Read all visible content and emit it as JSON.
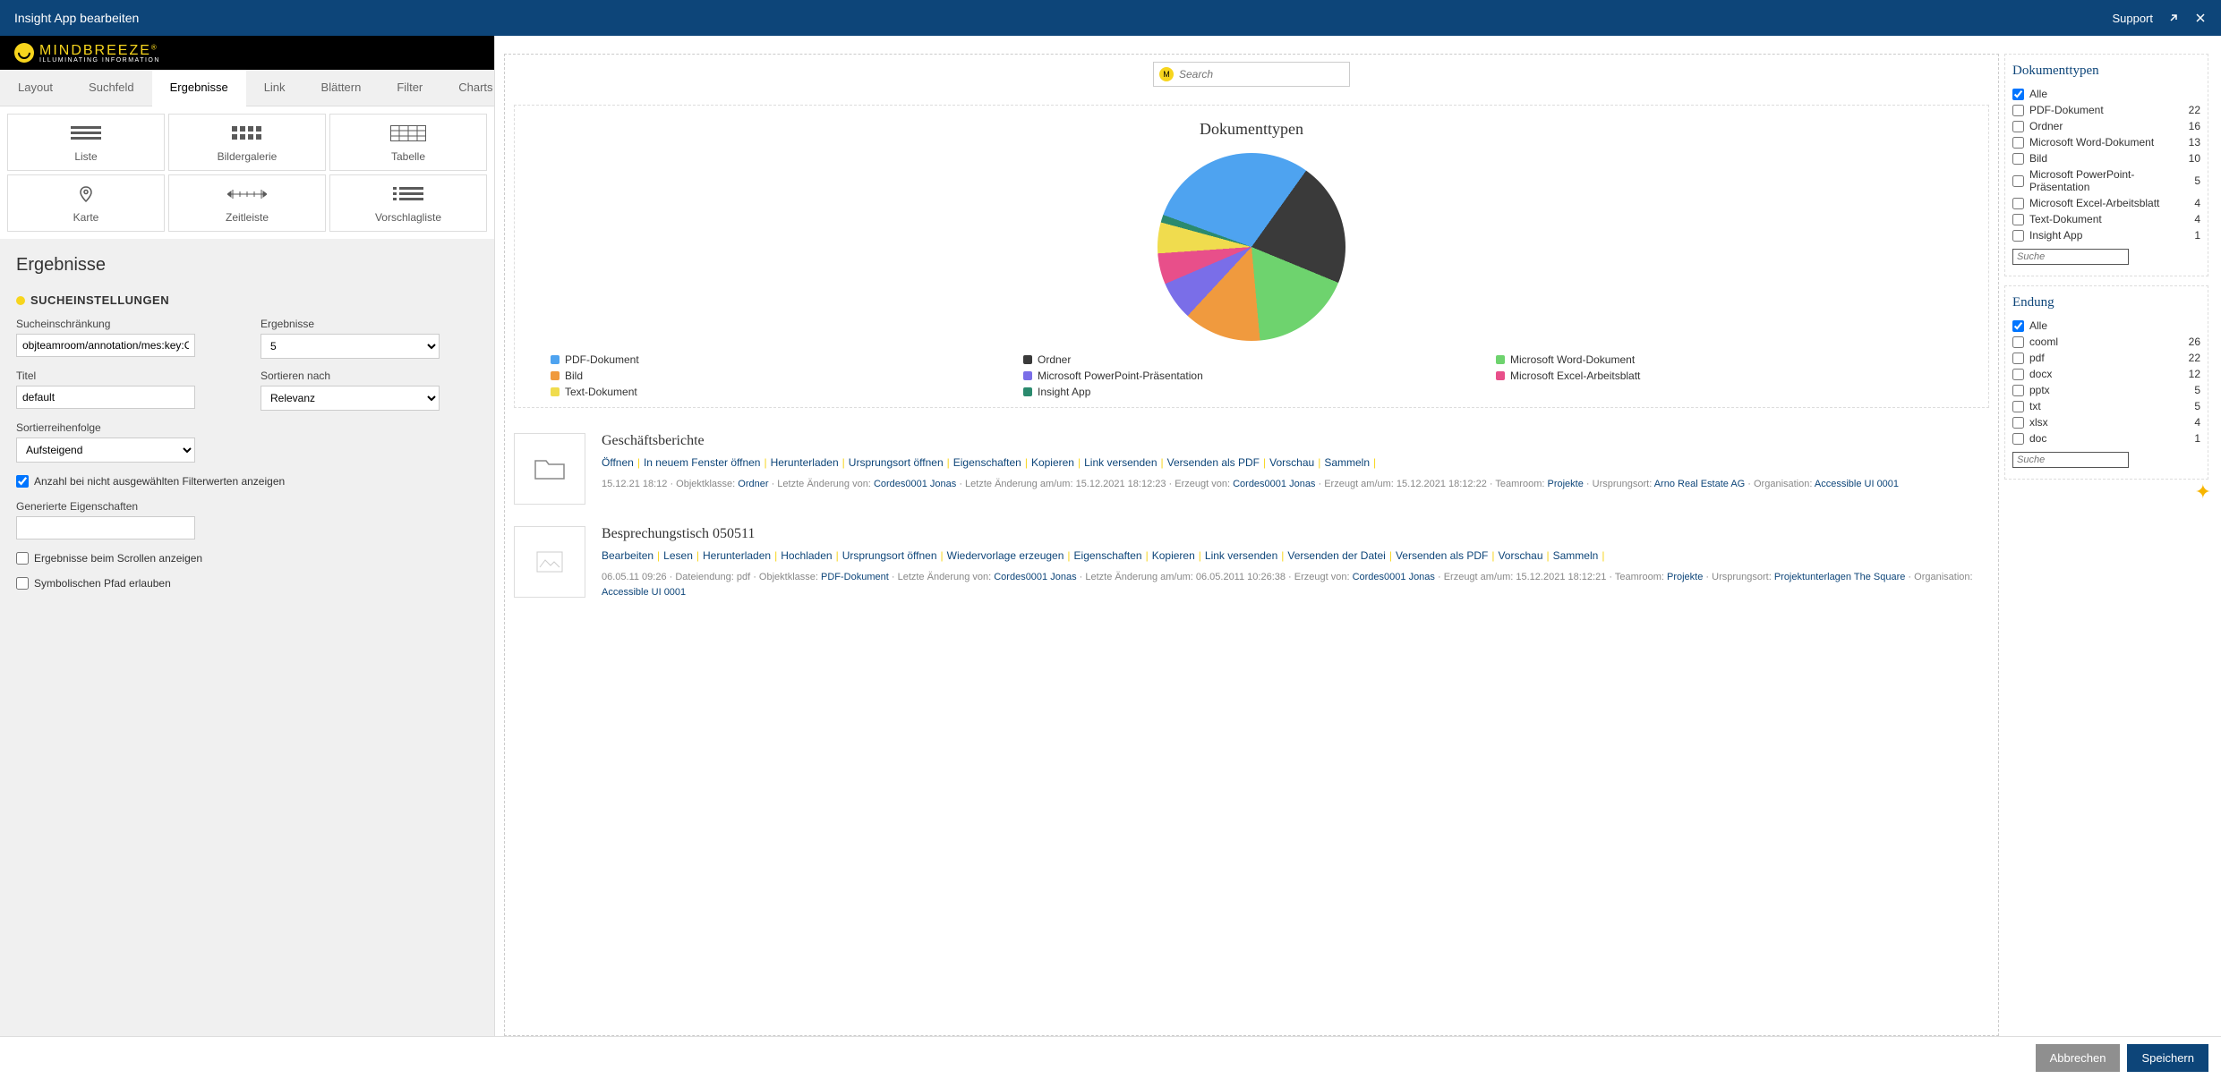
{
  "titlebar": {
    "title": "Insight App bearbeiten",
    "support": "Support"
  },
  "logo": {
    "brand": "MINDBREEZE",
    "sub": "ILLUMINATING INFORMATION",
    "reg": "®"
  },
  "tabs": [
    {
      "label": "Layout"
    },
    {
      "label": "Suchfeld"
    },
    {
      "label": "Ergebnisse",
      "active": true
    },
    {
      "label": "Link"
    },
    {
      "label": "Blättern"
    },
    {
      "label": "Filter"
    },
    {
      "label": "Charts"
    }
  ],
  "viewCards": [
    {
      "label": "Liste",
      "icon": "list"
    },
    {
      "label": "Bildergalerie",
      "icon": "grid"
    },
    {
      "label": "Tabelle",
      "icon": "table"
    },
    {
      "label": "Karte",
      "icon": "map"
    },
    {
      "label": "Zeitleiste",
      "icon": "timeline"
    },
    {
      "label": "Vorschlagliste",
      "icon": "suggest"
    }
  ],
  "settings": {
    "heading": "Ergebnisse",
    "section": "SUCHEINSTELLUNGEN",
    "sucheinschr_label": "Sucheinschränkung",
    "sucheinschr_value": "objteamroom/annotation/mes:key:CC",
    "ergebnisse_label": "Ergebnisse",
    "ergebnisse_value": "5",
    "titel_label": "Titel",
    "titel_value": "default",
    "sortnach_label": "Sortieren nach",
    "sortnach_value": "Relevanz",
    "sortreih_label": "Sortierreihenfolge",
    "sortreih_value": "Aufsteigend",
    "chk_anzahl": "Anzahl bei nicht ausgewählten Filterwerten anzeigen",
    "gen_label": "Generierte Eigenschaften",
    "chk_scroll": "Ergebnisse beim Scrollen anzeigen",
    "chk_symbol": "Symbolischen Pfad erlauben"
  },
  "search": {
    "placeholder": "Search"
  },
  "chart_data": {
    "type": "pie",
    "title": "Dokumenttypen",
    "series": [
      {
        "name": "PDF-Dokument",
        "value": 22,
        "color": "#4ea3f0"
      },
      {
        "name": "Ordner",
        "value": 16,
        "color": "#3a3a3a"
      },
      {
        "name": "Microsoft Word-Dokument",
        "value": 13,
        "color": "#6ed36e"
      },
      {
        "name": "Bild",
        "value": 10,
        "color": "#f09a3e"
      },
      {
        "name": "Microsoft PowerPoint-Präsentation",
        "value": 5,
        "color": "#7a6ee8"
      },
      {
        "name": "Microsoft Excel-Arbeitsblatt",
        "value": 4,
        "color": "#e84f8a"
      },
      {
        "name": "Text-Dokument",
        "value": 4,
        "color": "#f0dc4e"
      },
      {
        "name": "Insight App",
        "value": 1,
        "color": "#2b8a6e"
      }
    ]
  },
  "results": [
    {
      "title": "Geschäftsberichte",
      "icon": "folder",
      "actions": [
        "Öffnen",
        "In neuem Fenster öffnen",
        "Herunterladen",
        "Ursprungsort öffnen",
        "Eigenschaften",
        "Kopieren",
        "Link versenden",
        "Versenden als PDF",
        "Vorschau",
        "Sammeln"
      ],
      "meta_pre": "15.12.21 18:12 · Objektklasse: ",
      "meta_klasse": "Ordner",
      "meta_mid1": " · Letzte Änderung von: ",
      "meta_user1": "Cordes0001 Jonas",
      "meta_mid2": " · Letzte Änderung am/um: 15.12.2021 18:12:23 · Erzeugt von: ",
      "meta_user2": "Cordes0001 Jonas",
      "meta_mid3": " · Erzeugt am/um: 15.12.2021 18:12:22 · Teamroom: ",
      "meta_team": "Projekte",
      "meta_mid4": " · Ursprungsort: ",
      "meta_org1": "Arno Real Estate AG",
      "meta_mid5": " · Organisation: ",
      "meta_org2": "Accessible UI 0001"
    },
    {
      "title": "Besprechungstisch 050511",
      "icon": "image",
      "actions": [
        "Bearbeiten",
        "Lesen",
        "Herunterladen",
        "Hochladen",
        "Ursprungsort öffnen",
        "Wiedervorlage erzeugen",
        "Eigenschaften",
        "Kopieren",
        "Link versenden",
        "Versenden der Datei",
        "Versenden als PDF",
        "Vorschau",
        "Sammeln"
      ],
      "meta_pre": "06.05.11 09:26 · Dateiendung: pdf · Objektklasse: ",
      "meta_klasse": "PDF-Dokument",
      "meta_mid1": " · Letzte Änderung von: ",
      "meta_user1": "Cordes0001 Jonas",
      "meta_mid2": " · Letzte Änderung am/um: 06.05.2011 10:26:38 · Erzeugt von: ",
      "meta_user2": "Cordes0001 Jonas",
      "meta_mid3": " · Erzeugt am/um: 15.12.2021 18:12:21 · Teamroom: ",
      "meta_team": "Projekte",
      "meta_mid4": " · Ursprungsort: ",
      "meta_org1": "Projektunterlagen The Square",
      "meta_mid5": " · Organisation: ",
      "meta_org2": "Accessible UI 0001"
    }
  ],
  "filters": {
    "doktypen": {
      "title": "Dokumenttypen",
      "all": "Alle",
      "items": [
        {
          "label": "PDF-Dokument",
          "count": 22
        },
        {
          "label": "Ordner",
          "count": 16
        },
        {
          "label": "Microsoft Word-Dokument",
          "count": 13
        },
        {
          "label": "Bild",
          "count": 10
        },
        {
          "label": "Microsoft PowerPoint-Präsentation",
          "count": 5
        },
        {
          "label": "Microsoft Excel-Arbeitsblatt",
          "count": 4
        },
        {
          "label": "Text-Dokument",
          "count": 4
        },
        {
          "label": "Insight App",
          "count": 1
        }
      ],
      "search": "Suche"
    },
    "endung": {
      "title": "Endung",
      "all": "Alle",
      "items": [
        {
          "label": "cooml",
          "count": 26
        },
        {
          "label": "pdf",
          "count": 22
        },
        {
          "label": "docx",
          "count": 12
        },
        {
          "label": "pptx",
          "count": 5
        },
        {
          "label": "txt",
          "count": 5
        },
        {
          "label": "xlsx",
          "count": 4
        },
        {
          "label": "doc",
          "count": 1
        }
      ],
      "search": "Suche"
    }
  },
  "footer": {
    "cancel": "Abbrechen",
    "save": "Speichern"
  }
}
